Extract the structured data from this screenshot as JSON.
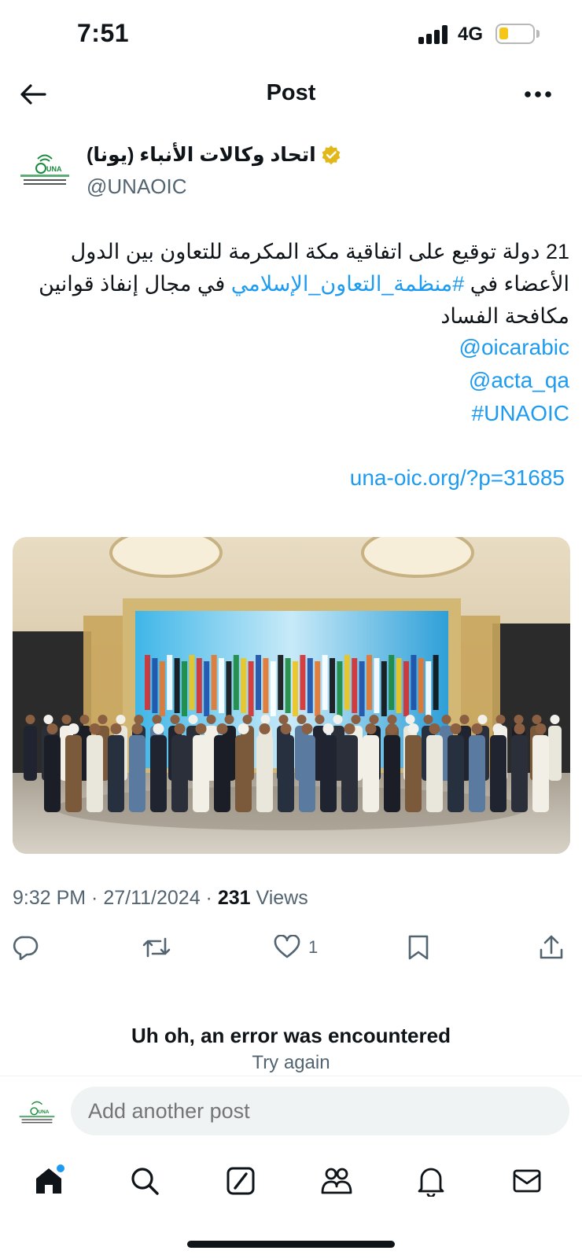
{
  "status_bar": {
    "time": "7:51",
    "network": "4G",
    "battery_color": "#f5c518"
  },
  "header": {
    "title": "Post"
  },
  "author": {
    "name": "اتحاد وكالات الأنباء (يونا)",
    "handle": "@UNAOIC",
    "verified_icon": "verified-gold-badge",
    "avatar_logo_text": "UNA"
  },
  "post": {
    "line1": "21 دولة توقيع على اتفاقية مكة المكرمة للتعاون بين الدول",
    "line2_prefix": "الأعضاء في ",
    "hashtag_arabic": "#منظمة_التعاون_الإسلامي",
    "line2_suffix": " في مجال إنفاذ قوانين",
    "line3": "مكافحة الفساد",
    "mention1": "@oicarabic",
    "mention2": "@acta_qa",
    "hashtag": "#UNAOIC",
    "link": "una-oic.org/?p=31685"
  },
  "meta": {
    "time": "9:32 PM",
    "date": "27/11/2024",
    "views_count": "231",
    "views_label": "Views",
    "separator": " · "
  },
  "actions": {
    "like_count": "1"
  },
  "error": {
    "title": "Uh oh, an error was encountered",
    "retry": "Try again"
  },
  "reply": {
    "placeholder": "Add another post"
  },
  "colors": {
    "accent": "#1d9bf0",
    "text": "#0f1419",
    "secondary": "#536471"
  }
}
